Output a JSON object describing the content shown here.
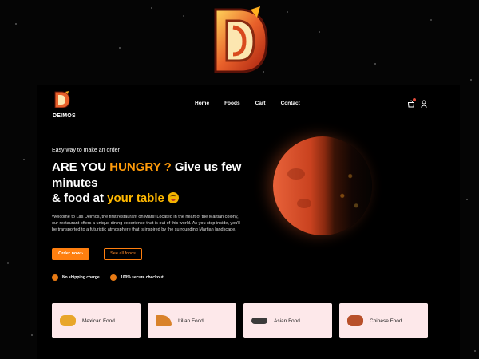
{
  "brand": {
    "name": "DEIMOS",
    "logo_letters": "D"
  },
  "nav": {
    "links": [
      "Home",
      "Foods",
      "Cart",
      "Contact"
    ]
  },
  "hero": {
    "eyebrow": "Easy way to make an order",
    "headline_part1": "ARE YOU ",
    "headline_hungry": "HUNGRY ?",
    "headline_part2": " Give us few minutes",
    "headline_part3": "& food at ",
    "headline_table": "your table",
    "description": "Welcome to Las Deimos, the first restaurant on Mars! Located in the heart of the Martian colony, our restaurant offers a unique dining experience that is out of this world. As you step inside, you'll be transported to a futuristic atmosphere that is inspired by the surrounding Martian landscape.",
    "order_button": "Order now ›",
    "see_all_button": "See all foods"
  },
  "features": [
    {
      "label": "No shipping charge"
    },
    {
      "label": "100% secure checkout"
    }
  ],
  "categories": [
    {
      "label": "Mexican Food",
      "icon": "taco-icon",
      "color": "#e8a62a"
    },
    {
      "label": "Itilian Food",
      "icon": "pizza-icon",
      "color": "#d9822b"
    },
    {
      "label": "Asian Food",
      "icon": "noodle-bowl-icon",
      "color": "#3b3b3b"
    },
    {
      "label": "Chinese Food",
      "icon": "dumpling-bowl-icon",
      "color": "#b8502a"
    }
  ],
  "colors": {
    "accent": "#ff7f0f",
    "hungry": "#ff9b0a",
    "table": "#ffb800",
    "card_bg": "#fde8ea"
  }
}
